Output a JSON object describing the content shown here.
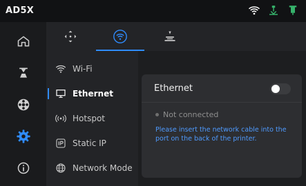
{
  "header": {
    "title": "AD5X",
    "status_icons": [
      "wifi-icon",
      "printer-status-icon",
      "filament-spool-icon"
    ]
  },
  "left_nav": {
    "items": [
      {
        "name": "home-icon",
        "active": false
      },
      {
        "name": "printer-tools-icon",
        "active": false
      },
      {
        "name": "filament-icon",
        "active": false
      },
      {
        "name": "settings-gear-icon",
        "active": true
      },
      {
        "name": "info-icon",
        "active": false
      }
    ]
  },
  "tabs": [
    {
      "name": "move-axes-icon",
      "active": false
    },
    {
      "name": "network-icon",
      "active": true
    },
    {
      "name": "print-calibration-icon",
      "active": false
    }
  ],
  "network_menu": {
    "items": [
      {
        "label": "Wi-Fi",
        "icon": "wifi-icon",
        "active": false
      },
      {
        "label": "Ethernet",
        "icon": "monitor-icon",
        "active": true
      },
      {
        "label": "Hotspot",
        "icon": "hotspot-icon",
        "active": false
      },
      {
        "label": "Static IP",
        "icon": "ip-icon",
        "active": false
      },
      {
        "label": "Network Mode",
        "icon": "globe-icon",
        "active": false
      }
    ]
  },
  "ethernet_panel": {
    "title": "Ethernet",
    "toggle_state": "off",
    "status": "Not connected",
    "hint": "Please insert the network cable into the port on the back of the printer."
  },
  "colors": {
    "accent": "#2f8cff",
    "hint": "#4f9bff",
    "printer_status": "#36b36b"
  }
}
